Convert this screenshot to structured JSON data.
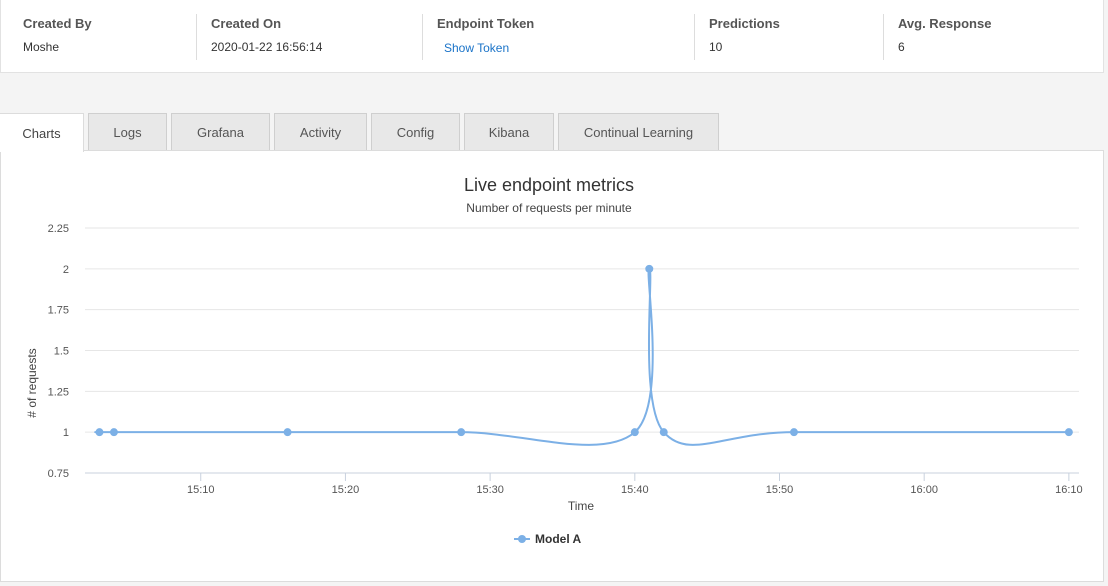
{
  "info": {
    "created_by_label": "Created By",
    "created_by_value": "Moshe",
    "created_on_label": "Created On",
    "created_on_value": "2020-01-22 16:56:14",
    "endpoint_token_label": "Endpoint Token",
    "endpoint_token_link": "Show Token",
    "predictions_label": "Predictions",
    "predictions_value": "10",
    "avg_response_label": "Avg. Response",
    "avg_response_value": "6"
  },
  "tabs": [
    {
      "label": "Charts",
      "active": true
    },
    {
      "label": "Logs",
      "active": false
    },
    {
      "label": "Grafana",
      "active": false
    },
    {
      "label": "Activity",
      "active": false
    },
    {
      "label": "Config",
      "active": false
    },
    {
      "label": "Kibana",
      "active": false
    },
    {
      "label": "Continual Learning",
      "active": false
    }
  ],
  "chart_data": {
    "type": "line",
    "title": "Live endpoint metrics",
    "subtitle": "Number of requests per minute",
    "xlabel": "Time",
    "ylabel": "# of requests",
    "x_tick_labels": [
      "15:10",
      "15:20",
      "15:30",
      "15:40",
      "15:50",
      "16:00",
      "16:10"
    ],
    "x_tick_minutes": [
      910,
      920,
      930,
      940,
      950,
      960,
      970
    ],
    "xlim_minutes": [
      902,
      970.7
    ],
    "ylim": [
      0.75,
      2.25
    ],
    "y_ticks": [
      0.75,
      1,
      1.25,
      1.5,
      1.75,
      2,
      2.25
    ],
    "y_tick_labels": [
      "0.75",
      "1",
      "1.25",
      "1.5",
      "1.75",
      "2",
      "2.25"
    ],
    "grid": true,
    "legend_position": "bottom-center",
    "series": [
      {
        "name": "Model A",
        "color": "#7cb0e6",
        "x": [
          "15:03",
          "15:04",
          "15:16",
          "15:28",
          "15:40",
          "15:41",
          "15:42",
          "15:51",
          "16:10"
        ],
        "x_minutes": [
          903,
          904,
          916,
          928,
          940,
          941,
          942,
          951,
          970
        ],
        "values": [
          1,
          1,
          1,
          1,
          1,
          2,
          1,
          1,
          1
        ]
      }
    ]
  }
}
